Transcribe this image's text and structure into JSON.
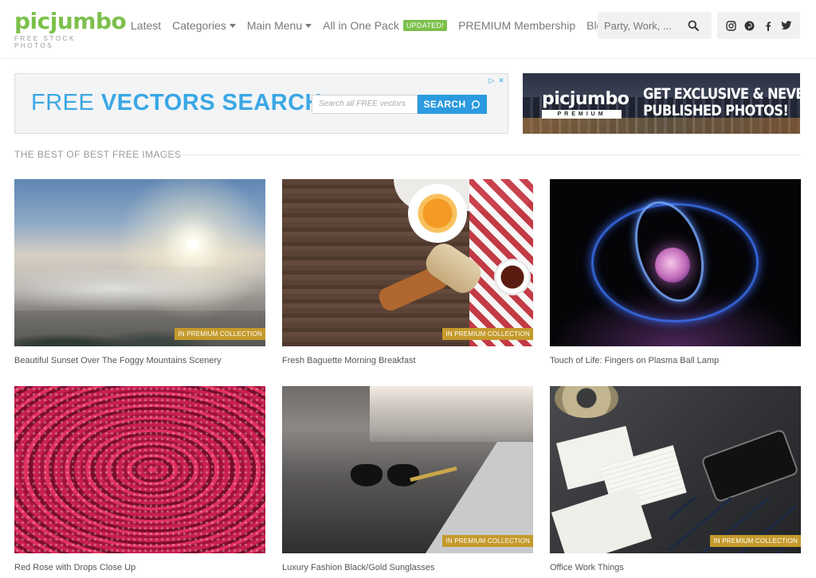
{
  "header": {
    "logo_main": "picjumbo",
    "logo_sub": "FREE STOCK PHOTOS",
    "nav": [
      {
        "label": "Latest",
        "has_caret": false
      },
      {
        "label": "Categories",
        "has_caret": true
      },
      {
        "label": "Main Menu",
        "has_caret": true
      },
      {
        "label": "All in One Pack",
        "badge": "UPDATED!"
      },
      {
        "label": "PREMIUM Membership"
      },
      {
        "label": "Blog"
      }
    ],
    "search_placeholder": "Party, Work, ...",
    "icons": [
      "search-icon",
      "instagram-icon",
      "pinterest-icon",
      "facebook-icon",
      "twitter-icon"
    ]
  },
  "ads": {
    "left": {
      "title_light": "FREE",
      "title_bold": "VECTORS SEARCH",
      "input_placeholder": "Search all FREE vectors",
      "button": "SEARCH"
    },
    "right": {
      "logo": "picjumbo",
      "premium": "PREMIUM",
      "line1": "GET EXCLUSIVE & NEVER",
      "line2": "PUBLISHED PHOTOS!"
    }
  },
  "section": {
    "title": "THE BEST OF BEST FREE IMAGES"
  },
  "photos": [
    {
      "caption": "Beautiful Sunset Over The Foggy Mountains Scenery",
      "tag": "IN PREMIUM COLLECTION"
    },
    {
      "caption": "Fresh Baguette Morning Breakfast",
      "tag": "IN PREMIUM COLLECTION"
    },
    {
      "caption": "Touch of Life: Fingers on Plasma Ball Lamp",
      "tag": ""
    },
    {
      "caption": "Red Rose with Drops Close Up",
      "tag": ""
    },
    {
      "caption": "Luxury Fashion Black/Gold Sunglasses",
      "tag": "IN PREMIUM COLLECTION"
    },
    {
      "caption": "Office Work Things",
      "tag": "IN PREMIUM COLLECTION"
    }
  ],
  "colors": {
    "brand_green": "#7cc04b",
    "vector_blue": "#3aa7e5",
    "premium_tag": "#c49a2c"
  }
}
